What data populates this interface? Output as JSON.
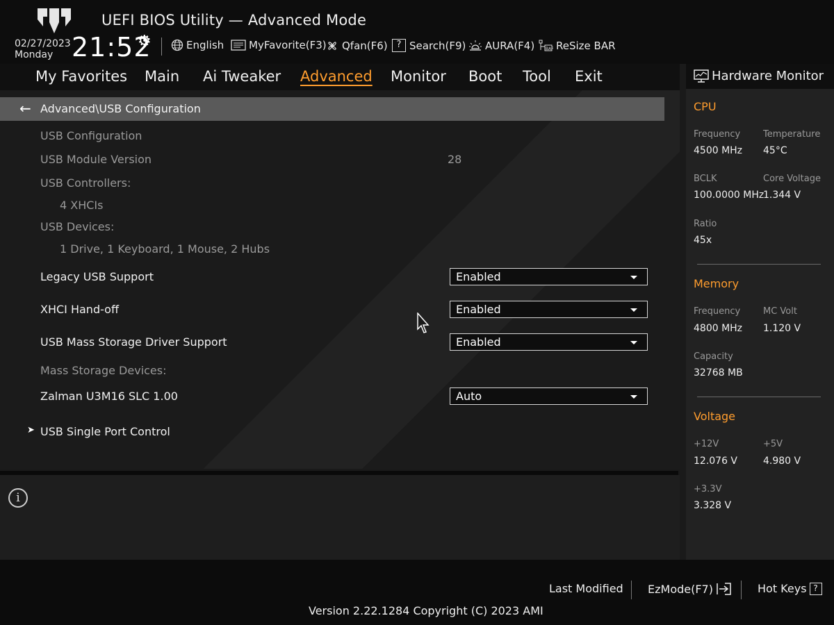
{
  "header": {
    "title": "UEFI BIOS Utility — Advanced Mode",
    "date": "02/27/2023",
    "day": "Monday",
    "time": "21:52",
    "tools": [
      {
        "label": "English",
        "icon": "globe-icon"
      },
      {
        "label": "MyFavorite(F3)",
        "icon": "favorite-icon"
      },
      {
        "label": "Qfan(F6)",
        "icon": "fan-icon"
      },
      {
        "label": "Search(F9)",
        "icon": "search-icon"
      },
      {
        "label": "AURA(F4)",
        "icon": "aura-icon"
      },
      {
        "label": "ReSize BAR",
        "icon": "resize-bar-icon"
      }
    ]
  },
  "nav": {
    "tabs": [
      "My Favorites",
      "Main",
      "Ai Tweaker",
      "Advanced",
      "Monitor",
      "Boot",
      "Tool",
      "Exit"
    ],
    "active": "Advanced"
  },
  "content": {
    "breadcrumb": "Advanced\\USB Configuration",
    "section_title": "USB Configuration",
    "module_version_label": "USB Module Version",
    "module_version_value": "28",
    "controllers_label": "USB Controllers:",
    "controllers_value": "4 XHCIs",
    "devices_label": "USB Devices:",
    "devices_value": "1 Drive, 1 Keyboard, 1 Mouse, 2 Hubs",
    "settings": [
      {
        "label": "Legacy USB Support",
        "value": "Enabled"
      },
      {
        "label": "XHCI Hand-off",
        "value": "Enabled"
      },
      {
        "label": "USB Mass Storage Driver Support",
        "value": "Enabled"
      }
    ],
    "mass_storage_label": "Mass Storage Devices:",
    "device_setting": {
      "label": "Zalman U3M16 SLC 1.00",
      "value": "Auto"
    },
    "submenu": "USB Single Port Control"
  },
  "hardware_monitor": {
    "title": "Hardware Monitor",
    "cpu": {
      "heading": "CPU",
      "frequency_label": "Frequency",
      "frequency": "4500 MHz",
      "temperature_label": "Temperature",
      "temperature": "45°C",
      "bclk_label": "BCLK",
      "bclk": "100.0000 MHz",
      "core_voltage_label": "Core Voltage",
      "core_voltage": "1.344 V",
      "ratio_label": "Ratio",
      "ratio": "45x"
    },
    "memory": {
      "heading": "Memory",
      "frequency_label": "Frequency",
      "frequency": "4800 MHz",
      "mc_volt_label": "MC Volt",
      "mc_volt": "1.120 V",
      "capacity_label": "Capacity",
      "capacity": "32768 MB"
    },
    "voltage": {
      "heading": "Voltage",
      "v12_label": "+12V",
      "v12": "12.076 V",
      "v5_label": "+5V",
      "v5": "4.980 V",
      "v33_label": "+3.3V",
      "v33": "3.328 V"
    }
  },
  "footer": {
    "last_modified": "Last Modified",
    "ezmode": "EzMode(F7)",
    "hot_keys": "Hot Keys",
    "hot_keys_icon_text": "?",
    "version": "Version 2.22.1284 Copyright (C) 2023 AMI"
  },
  "colors": {
    "accent": "#ff9d2e",
    "background": "#1b1b1b",
    "highlight_bar": "#5a5a5a"
  }
}
